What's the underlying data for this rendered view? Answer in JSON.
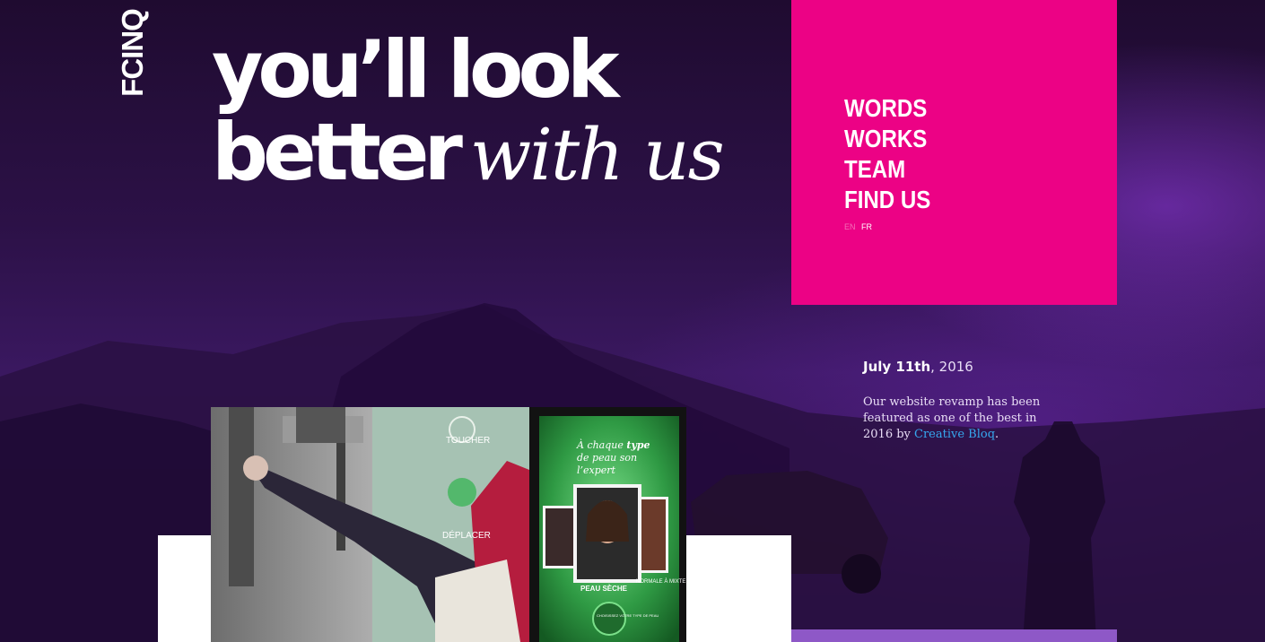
{
  "brand": {
    "logo_text": "FCINQ"
  },
  "hero": {
    "line1": "you’ll look",
    "line2_bold": "better",
    "line2_script": "with us"
  },
  "nav": {
    "items": [
      "WORDS",
      "WORKS",
      "TEAM",
      "FIND US"
    ],
    "lang_en": "EN",
    "lang_fr": "FR"
  },
  "news": {
    "date_bold": "July 11th",
    "date_rest": ", 2016",
    "text_before": "Our website revamp has been featured as one of the best in 2016 by ",
    "link_text": "Creative Bloq",
    "text_after": "."
  },
  "showcase": {
    "sign_touch": "TOUCHER",
    "sign_move": "DÉPLACER",
    "screen_title_1": "À chaque",
    "screen_title_bold": "type",
    "screen_title_2": "de peau son",
    "screen_title_3": "l’expert",
    "screen_caption": "PEAU SÈCHE",
    "screen_side": "NORMALE À MIXTE",
    "screen_button": "CHOISISSEZ VOTRE TYPE DE PEAU"
  },
  "colors": {
    "menu_bg": "#ec0285",
    "link": "#36a8ef",
    "accent_strip": "#8e58c7",
    "sky_purple": "#2c1147"
  }
}
